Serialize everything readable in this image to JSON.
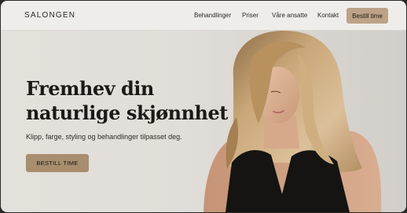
{
  "nav": {
    "logo": "SALONGEN",
    "links": [
      "Behandlinger",
      "Priser",
      "Våre ansatte",
      "Kontakt"
    ],
    "cta_label": "Bestill time"
  },
  "hero": {
    "headline_line1": "Fremhev din",
    "headline_line2": "naturlige skjønnhet",
    "subtitle": "Klipp, farge, styling og behandlinger tilpasset deg.",
    "cta_label": "BESTILL TIME"
  },
  "colors": {
    "accent": "#bda287",
    "cta": "#a78e6e",
    "text": "#1c1916"
  }
}
